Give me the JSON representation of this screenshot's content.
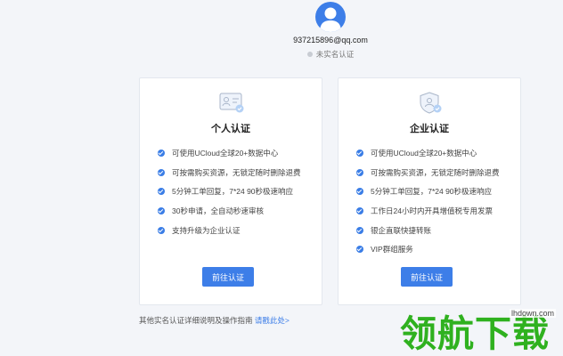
{
  "profile": {
    "email": "937215896@qq.com",
    "verification_status": "未实名认证"
  },
  "cards": [
    {
      "title": "个人认证",
      "icon": "id-card-icon",
      "features": [
        "可使用UCloud全球20+数据中心",
        "可按需购买资源，无锁定随时删除退费",
        "5分钟工单回复，7*24 90秒极速响应",
        "30秒申请，全自动秒速审核",
        "支持升级为企业认证"
      ],
      "button_label": "前往认证"
    },
    {
      "title": "企业认证",
      "icon": "enterprise-shield-icon",
      "features": [
        "可使用UCloud全球20+数据中心",
        "可按需购买资源，无锁定随时删除退费",
        "5分钟工单回复，7*24 90秒极速响应",
        "工作日24小时内开具增值税专用发票",
        "银企直联快捷转账",
        "VIP群组服务"
      ],
      "button_label": "前往认证"
    }
  ],
  "footer": {
    "note": "其他实名认证详细说明及操作指南",
    "link": "请戳此处>"
  },
  "watermark": {
    "text": "领航下载",
    "url": "lhdown.com"
  },
  "colors": {
    "accent": "#3d7ee8",
    "watermark": "#2fb11f"
  }
}
